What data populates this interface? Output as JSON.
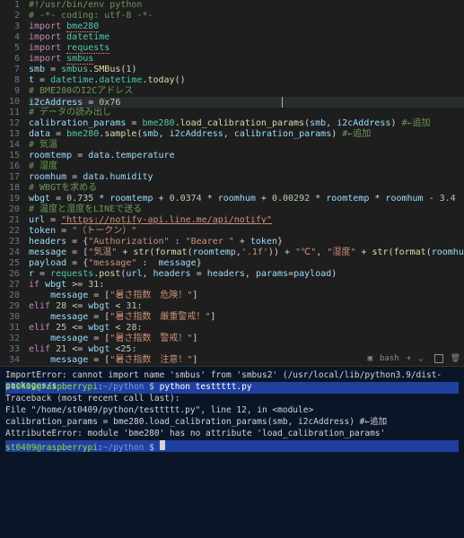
{
  "editor": {
    "lines": [
      {
        "n": 1,
        "seg": [
          {
            "t": "#!/usr/bin/env python",
            "c": "cmt"
          }
        ]
      },
      {
        "n": 2,
        "seg": [
          {
            "t": "# -*- coding: utf-8 -*-",
            "c": "cmt"
          }
        ]
      },
      {
        "n": 3,
        "seg": [
          {
            "t": "import",
            "c": "kw"
          },
          {
            "t": " ",
            "c": "op"
          },
          {
            "t": "bme280",
            "c": "cls underline"
          }
        ]
      },
      {
        "n": 4,
        "seg": [
          {
            "t": "import",
            "c": "kw"
          },
          {
            "t": " ",
            "c": "op"
          },
          {
            "t": "datetime",
            "c": "cls"
          }
        ]
      },
      {
        "n": 5,
        "seg": [
          {
            "t": "import",
            "c": "kw"
          },
          {
            "t": " ",
            "c": "op"
          },
          {
            "t": "requests",
            "c": "cls underline"
          }
        ]
      },
      {
        "n": 6,
        "seg": [
          {
            "t": "import",
            "c": "kw"
          },
          {
            "t": " ",
            "c": "op"
          },
          {
            "t": "smbus",
            "c": "cls underline"
          }
        ]
      },
      {
        "n": 7,
        "seg": [
          {
            "t": "smb",
            "c": "var"
          },
          {
            "t": " = ",
            "c": "op"
          },
          {
            "t": "smbus",
            "c": "cls"
          },
          {
            "t": ".",
            "c": "op"
          },
          {
            "t": "SMBus",
            "c": "fn"
          },
          {
            "t": "(",
            "c": "op"
          },
          {
            "t": "1",
            "c": "num"
          },
          {
            "t": ")",
            "c": "op"
          }
        ]
      },
      {
        "n": 8,
        "seg": [
          {
            "t": "t",
            "c": "var"
          },
          {
            "t": " = ",
            "c": "op"
          },
          {
            "t": "datetime",
            "c": "cls"
          },
          {
            "t": ".",
            "c": "op"
          },
          {
            "t": "datetime",
            "c": "cls"
          },
          {
            "t": ".",
            "c": "op"
          },
          {
            "t": "today",
            "c": "fn"
          },
          {
            "t": "()",
            "c": "op"
          }
        ]
      },
      {
        "n": 9,
        "seg": [
          {
            "t": "# BME280のI2Cアドレス",
            "c": "cmt"
          }
        ]
      },
      {
        "n": 10,
        "hl": true,
        "seg": [
          {
            "t": "i2cAddress",
            "c": "var"
          },
          {
            "t": " = ",
            "c": "op"
          },
          {
            "t": "0x76",
            "c": "num"
          }
        ],
        "cursor": true
      },
      {
        "n": 11,
        "seg": [
          {
            "t": "# データの読み出し",
            "c": "cmt"
          }
        ]
      },
      {
        "n": 12,
        "seg": [
          {
            "t": "calibration_params",
            "c": "var"
          },
          {
            "t": " = ",
            "c": "op"
          },
          {
            "t": "bme280",
            "c": "cls"
          },
          {
            "t": ".",
            "c": "op"
          },
          {
            "t": "load_calibration_params",
            "c": "fn"
          },
          {
            "t": "(",
            "c": "op"
          },
          {
            "t": "smb",
            "c": "var"
          },
          {
            "t": ", ",
            "c": "op"
          },
          {
            "t": "i2cAddress",
            "c": "var"
          },
          {
            "t": ") ",
            "c": "op"
          },
          {
            "t": "#←追加",
            "c": "cmt"
          }
        ]
      },
      {
        "n": 13,
        "seg": [
          {
            "t": "data",
            "c": "var"
          },
          {
            "t": " = ",
            "c": "op"
          },
          {
            "t": "bme280",
            "c": "cls"
          },
          {
            "t": ".",
            "c": "op"
          },
          {
            "t": "sample",
            "c": "fn"
          },
          {
            "t": "(",
            "c": "op"
          },
          {
            "t": "smb",
            "c": "var"
          },
          {
            "t": ", ",
            "c": "op"
          },
          {
            "t": "i2cAddress",
            "c": "var"
          },
          {
            "t": ", ",
            "c": "op"
          },
          {
            "t": "calibration_params",
            "c": "var"
          },
          {
            "t": ") ",
            "c": "op"
          },
          {
            "t": "#←追加",
            "c": "cmt"
          }
        ]
      },
      {
        "n": 14,
        "seg": [
          {
            "t": "# 気温",
            "c": "cmt"
          }
        ]
      },
      {
        "n": 15,
        "seg": [
          {
            "t": "roomtemp",
            "c": "var"
          },
          {
            "t": " = ",
            "c": "op"
          },
          {
            "t": "data",
            "c": "var"
          },
          {
            "t": ".",
            "c": "op"
          },
          {
            "t": "temperature",
            "c": "var"
          }
        ]
      },
      {
        "n": 16,
        "seg": [
          {
            "t": "# 湿度",
            "c": "cmt"
          }
        ]
      },
      {
        "n": 17,
        "seg": [
          {
            "t": "roomhum",
            "c": "var"
          },
          {
            "t": " = ",
            "c": "op"
          },
          {
            "t": "data",
            "c": "var"
          },
          {
            "t": ".",
            "c": "op"
          },
          {
            "t": "humidity",
            "c": "var"
          }
        ]
      },
      {
        "n": 18,
        "seg": [
          {
            "t": "# WBGTを求める",
            "c": "cmt"
          }
        ]
      },
      {
        "n": 19,
        "seg": [
          {
            "t": "wbgt",
            "c": "var"
          },
          {
            "t": " = ",
            "c": "op"
          },
          {
            "t": "0.735",
            "c": "num"
          },
          {
            "t": " * ",
            "c": "op"
          },
          {
            "t": "roomtemp",
            "c": "var"
          },
          {
            "t": " + ",
            "c": "op"
          },
          {
            "t": "0.0374",
            "c": "num"
          },
          {
            "t": " * ",
            "c": "op"
          },
          {
            "t": "roomhum",
            "c": "var"
          },
          {
            "t": " + ",
            "c": "op"
          },
          {
            "t": "0.00292",
            "c": "num"
          },
          {
            "t": " * ",
            "c": "op"
          },
          {
            "t": "roomtemp",
            "c": "var"
          },
          {
            "t": " * ",
            "c": "op"
          },
          {
            "t": "roomhum",
            "c": "var"
          },
          {
            "t": " - ",
            "c": "op"
          },
          {
            "t": "3.4",
            "c": "num"
          }
        ]
      },
      {
        "n": 20,
        "seg": [
          {
            "t": "# 温度と湿度をLINEで送る",
            "c": "cmt"
          }
        ]
      },
      {
        "n": 21,
        "seg": [
          {
            "t": "url",
            "c": "var"
          },
          {
            "t": " = ",
            "c": "op"
          },
          {
            "t": "\"https://notify-api.line.me/api/notify\"",
            "c": "url"
          }
        ]
      },
      {
        "n": 22,
        "seg": [
          {
            "t": "token",
            "c": "var"
          },
          {
            "t": " = ",
            "c": "op"
          },
          {
            "t": "\"（トークン）\"",
            "c": "str"
          }
        ]
      },
      {
        "n": 23,
        "seg": [
          {
            "t": "headers",
            "c": "var"
          },
          {
            "t": " = {",
            "c": "op"
          },
          {
            "t": "\"Authorization\"",
            "c": "str"
          },
          {
            "t": " : ",
            "c": "op"
          },
          {
            "t": "\"Bearer \"",
            "c": "str"
          },
          {
            "t": " + ",
            "c": "op"
          },
          {
            "t": "token",
            "c": "var"
          },
          {
            "t": "}",
            "c": "op"
          }
        ]
      },
      {
        "n": 24,
        "seg": [
          {
            "t": "message",
            "c": "var"
          },
          {
            "t": " = [",
            "c": "op"
          },
          {
            "t": "\"気温\"",
            "c": "str"
          },
          {
            "t": " + ",
            "c": "op"
          },
          {
            "t": "str",
            "c": "fn"
          },
          {
            "t": "(",
            "c": "op"
          },
          {
            "t": "format",
            "c": "fn"
          },
          {
            "t": "(",
            "c": "op"
          },
          {
            "t": "roomtemp",
            "c": "var"
          },
          {
            "t": ",",
            "c": "op"
          },
          {
            "t": "'.1f'",
            "c": "str"
          },
          {
            "t": ")) + ",
            "c": "op"
          },
          {
            "t": "\"℃\"",
            "c": "str"
          },
          {
            "t": ", ",
            "c": "op"
          },
          {
            "t": "\"湿度\"",
            "c": "str"
          },
          {
            "t": " + ",
            "c": "op"
          },
          {
            "t": "str",
            "c": "fn"
          },
          {
            "t": "(",
            "c": "op"
          },
          {
            "t": "format",
            "c": "fn"
          },
          {
            "t": "(",
            "c": "op"
          },
          {
            "t": "roomhu",
            "c": "var"
          }
        ]
      },
      {
        "n": 25,
        "seg": [
          {
            "t": "payload",
            "c": "var"
          },
          {
            "t": " = {",
            "c": "op"
          },
          {
            "t": "\"message\"",
            "c": "str"
          },
          {
            "t": " :  ",
            "c": "op"
          },
          {
            "t": "message",
            "c": "var"
          },
          {
            "t": "}",
            "c": "op"
          }
        ]
      },
      {
        "n": 26,
        "seg": [
          {
            "t": "r",
            "c": "var"
          },
          {
            "t": " = ",
            "c": "op"
          },
          {
            "t": "requests",
            "c": "cls"
          },
          {
            "t": ".",
            "c": "op"
          },
          {
            "t": "post",
            "c": "fn"
          },
          {
            "t": "(",
            "c": "op"
          },
          {
            "t": "url",
            "c": "var"
          },
          {
            "t": ", ",
            "c": "op"
          },
          {
            "t": "headers",
            "c": "var"
          },
          {
            "t": " = ",
            "c": "op"
          },
          {
            "t": "headers",
            "c": "var"
          },
          {
            "t": ", ",
            "c": "op"
          },
          {
            "t": "params",
            "c": "var"
          },
          {
            "t": "=",
            "c": "op"
          },
          {
            "t": "payload",
            "c": "var"
          },
          {
            "t": ")",
            "c": "op"
          }
        ]
      },
      {
        "n": 27,
        "seg": [
          {
            "t": "if",
            "c": "kw"
          },
          {
            "t": " ",
            "c": "op"
          },
          {
            "t": "wbgt",
            "c": "var"
          },
          {
            "t": " >= ",
            "c": "op"
          },
          {
            "t": "31",
            "c": "num"
          },
          {
            "t": ":",
            "c": "op"
          }
        ]
      },
      {
        "n": 28,
        "seg": [
          {
            "t": "    ",
            "c": "op"
          },
          {
            "t": "message",
            "c": "var"
          },
          {
            "t": " = [",
            "c": "op"
          },
          {
            "t": "\"暑さ指数　危険！\"",
            "c": "str"
          },
          {
            "t": "]",
            "c": "op"
          }
        ]
      },
      {
        "n": 29,
        "seg": [
          {
            "t": "elif",
            "c": "kw"
          },
          {
            "t": " ",
            "c": "op"
          },
          {
            "t": "28",
            "c": "num"
          },
          {
            "t": " <= ",
            "c": "op"
          },
          {
            "t": "wbgt",
            "c": "var"
          },
          {
            "t": " < ",
            "c": "op"
          },
          {
            "t": "31",
            "c": "num"
          },
          {
            "t": ":",
            "c": "op"
          }
        ]
      },
      {
        "n": 30,
        "seg": [
          {
            "t": "    ",
            "c": "op"
          },
          {
            "t": "message",
            "c": "var"
          },
          {
            "t": " = [",
            "c": "op"
          },
          {
            "t": "\"暑さ指数　厳重警戒！\"",
            "c": "str"
          },
          {
            "t": "]",
            "c": "op"
          }
        ]
      },
      {
        "n": 31,
        "seg": [
          {
            "t": "elif",
            "c": "kw"
          },
          {
            "t": " ",
            "c": "op"
          },
          {
            "t": "25",
            "c": "num"
          },
          {
            "t": " <= ",
            "c": "op"
          },
          {
            "t": "wbgt",
            "c": "var"
          },
          {
            "t": " < ",
            "c": "op"
          },
          {
            "t": "28",
            "c": "num"
          },
          {
            "t": ":",
            "c": "op"
          }
        ]
      },
      {
        "n": 32,
        "seg": [
          {
            "t": "    ",
            "c": "op"
          },
          {
            "t": "message",
            "c": "var"
          },
          {
            "t": " = [",
            "c": "op"
          },
          {
            "t": "\"暑さ指数　警戒！\"",
            "c": "str"
          },
          {
            "t": "]",
            "c": "op"
          }
        ]
      },
      {
        "n": 33,
        "seg": [
          {
            "t": "elif",
            "c": "kw"
          },
          {
            "t": " ",
            "c": "op"
          },
          {
            "t": "21",
            "c": "num"
          },
          {
            "t": " <= ",
            "c": "op"
          },
          {
            "t": "wbgt",
            "c": "var"
          },
          {
            "t": " <",
            "c": "op"
          },
          {
            "t": "25",
            "c": "num"
          },
          {
            "t": ":",
            "c": "op"
          }
        ]
      },
      {
        "n": 34,
        "seg": [
          {
            "t": "    ",
            "c": "op"
          },
          {
            "t": "message",
            "c": "var"
          },
          {
            "t": " = [",
            "c": "op"
          },
          {
            "t": "\"暑さ指数　注意！\"",
            "c": "str"
          },
          {
            "t": "]",
            "c": "op"
          }
        ]
      }
    ]
  },
  "statusbar": {
    "shell": "bash",
    "plus": "+"
  },
  "terminal": {
    "lines": [
      {
        "type": "err",
        "text": "ImportError: cannot import name 'smbus' from 'smbus2' (/usr/local/lib/python3.9/dist-packages/s"
      },
      {
        "type": "prompt",
        "user": "st0409@raspberrypi",
        "path": "~/python",
        "sym": "$",
        "cmd": "python testtttt.py",
        "blue": true
      },
      {
        "type": "err",
        "text": "Traceback (most recent call last):"
      },
      {
        "type": "err",
        "text": "  File \"/home/st0409/python/testtttt.py\", line 12, in <module>"
      },
      {
        "type": "err",
        "text": "    calibration_params = bme280.load_calibration_params(smb, i2cAddress) #←追加"
      },
      {
        "type": "err",
        "text": "AttributeError: module 'bme280' has no attribute 'load_calibration_params'"
      },
      {
        "type": "prompt",
        "user": "st0409@raspberrypi",
        "path": "~/python",
        "sym": "$",
        "cmd": "",
        "blue": true,
        "cursor": true
      }
    ]
  }
}
